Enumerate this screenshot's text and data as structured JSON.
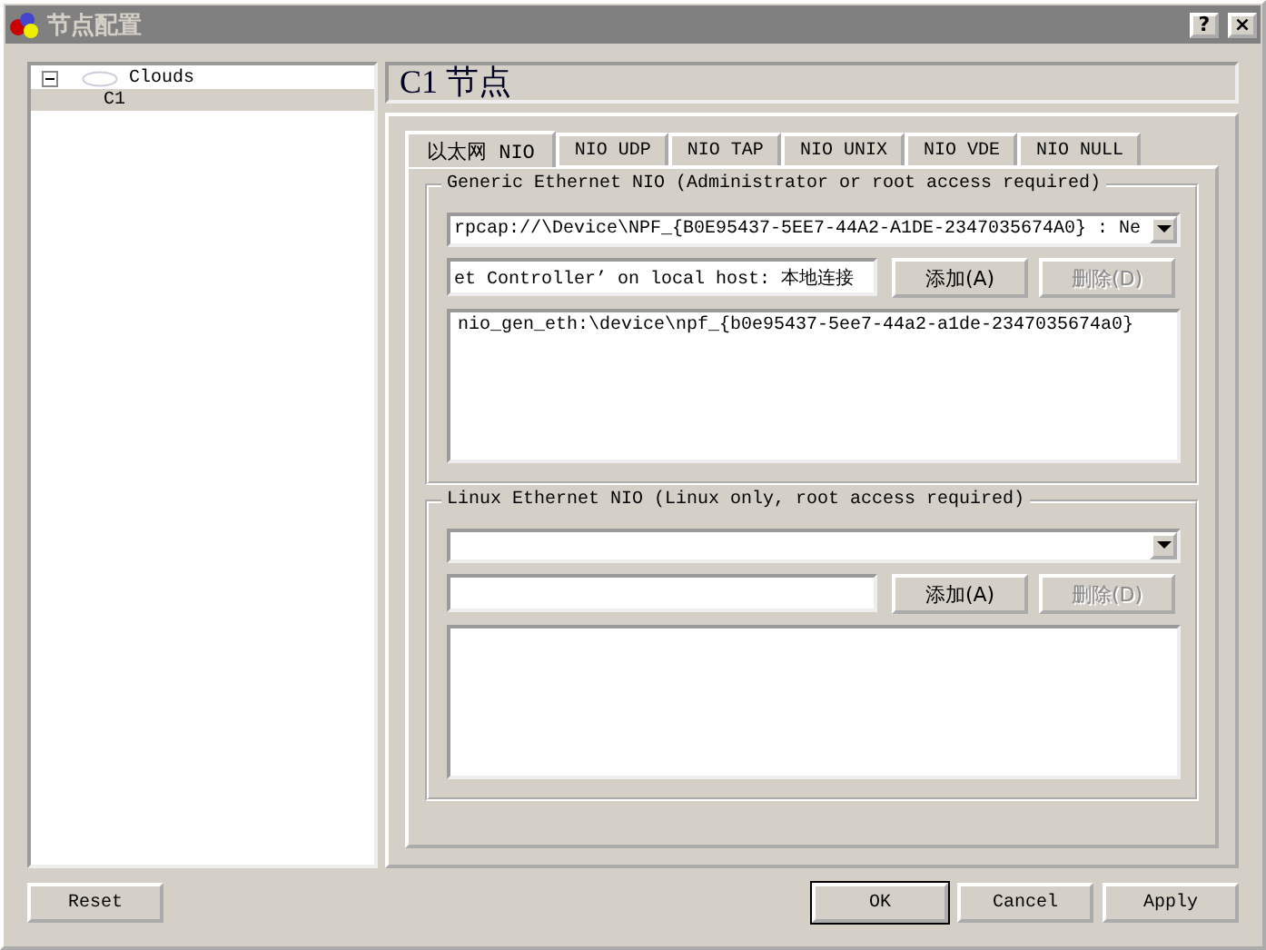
{
  "window": {
    "title": "节点配置",
    "help_button": "?",
    "close_button": "×"
  },
  "tree": [
    {
      "label": "Clouds",
      "expanded": true,
      "selected": false,
      "children": [
        {
          "label": "C1",
          "selected": true
        }
      ]
    }
  ],
  "header": "C1 节点",
  "tabs": [
    {
      "label": "以太网 NIO",
      "selected": true
    },
    {
      "label": "NIO UDP",
      "selected": false
    },
    {
      "label": "NIO TAP",
      "selected": false
    },
    {
      "label": "NIO UNIX",
      "selected": false
    },
    {
      "label": "NIO VDE",
      "selected": false
    },
    {
      "label": "NIO NULL",
      "selected": false
    }
  ],
  "groups": [
    {
      "title": "Generic Ethernet NIO (Administrator or root access required)",
      "combo_value": "rpcap://\\Device\\NPF_{B0E95437-5EE7-44A2-A1DE-2347035674A0} : Ne",
      "input_value": "et Controller’ on local host: 本地连接",
      "add_button": {
        "label": "添加(A)",
        "disabled": false
      },
      "delete_button": {
        "label": "删除(D)",
        "disabled": true
      },
      "list_items": [
        "nio_gen_eth:\\device\\npf_{b0e95437-5ee7-44a2-a1de-2347035674a0}"
      ]
    },
    {
      "title": "Linux Ethernet NIO (Linux only, root access required)",
      "add_button": {
        "label": "添加(A)",
        "disabled": false
      },
      "delete_button": {
        "label": "删除(D)",
        "disabled": true
      }
    }
  ],
  "buttons": {
    "reset": "Reset",
    "ok": "OK",
    "cancel": "Cancel",
    "apply": "Apply"
  }
}
